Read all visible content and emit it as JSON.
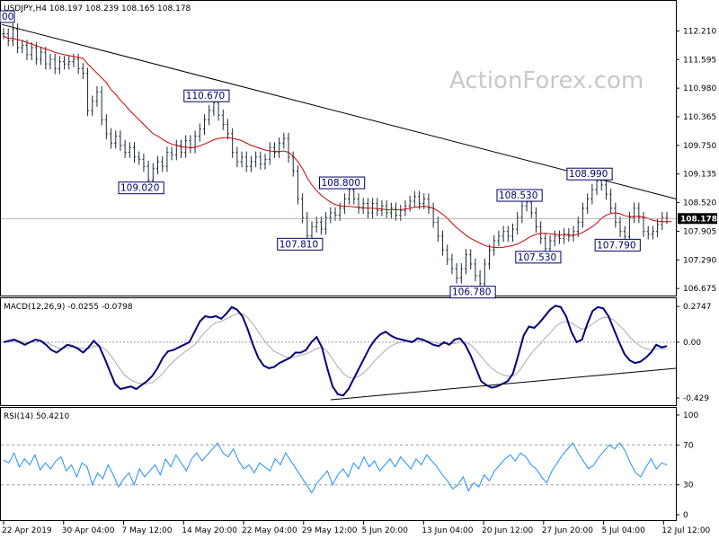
{
  "chart_data": [
    {
      "type": "line",
      "panel": "price",
      "header": "USDJPY,H4  108.197 108.239 108.165 108.178",
      "watermark": "ActionForex.com",
      "ylim": [
        106.6,
        112.45
      ],
      "yticks": [
        "112.210",
        "111.595",
        "110.980",
        "110.365",
        "109.750",
        "109.135",
        "108.520",
        "107.905",
        "107.290",
        "106.675"
      ],
      "current_price": "108.178",
      "partial_left_label": "00",
      "x_labels": [
        "22 Apr 2019",
        "30 Apr 04:00",
        "7 May 12:00",
        "14 May 20:00",
        "22 May 04:00",
        "29 May 12:00",
        "5 Jun 20:00",
        "13 Jun 04:00",
        "20 Jun 12:00",
        "27 Jun 20:00",
        "5 Jul 04:00",
        "12 Jul 12:00"
      ],
      "series": [
        {
          "values": [
            112.15,
            112.0,
            112.25,
            111.85,
            111.9,
            111.7,
            111.85,
            111.6,
            111.75,
            111.5,
            111.6,
            111.4,
            111.55,
            111.5,
            111.55,
            111.6,
            111.4,
            111.3,
            110.5,
            110.7,
            110.9,
            110.3,
            110.0,
            109.8,
            109.95,
            109.75,
            109.6,
            109.7,
            109.5,
            109.45,
            109.3,
            109.0,
            109.25,
            109.4,
            109.3,
            109.6,
            109.55,
            109.75,
            109.6,
            109.85,
            109.7,
            109.95,
            110.1,
            110.3,
            110.5,
            110.67,
            110.4,
            110.2,
            110.0,
            109.6,
            109.4,
            109.5,
            109.3,
            109.4,
            109.5,
            109.35,
            109.45,
            109.7,
            109.6,
            109.8,
            109.9,
            109.5,
            109.2,
            108.6,
            108.2,
            107.81,
            108.0,
            108.1,
            107.95,
            108.2,
            108.3,
            108.25,
            108.4,
            108.6,
            108.8,
            108.6,
            108.4,
            108.5,
            108.3,
            108.5,
            108.35,
            108.45,
            108.3,
            108.4,
            108.25,
            108.35,
            108.45,
            108.55,
            108.65,
            108.5,
            108.6,
            108.4,
            108.1,
            107.8,
            107.5,
            107.3,
            107.1,
            106.9,
            107.1,
            107.4,
            107.2,
            106.95,
            106.78,
            107.2,
            107.5,
            107.7,
            107.8,
            107.9,
            107.8,
            107.95,
            108.2,
            108.45,
            108.53,
            108.3,
            108.0,
            107.75,
            107.53,
            107.7,
            107.8,
            107.75,
            107.85,
            107.8,
            107.9,
            108.1,
            108.4,
            108.6,
            108.8,
            108.99,
            108.9,
            108.7,
            108.4,
            108.1,
            107.9,
            107.79,
            108.2,
            108.4,
            108.2,
            107.9,
            107.85,
            107.9,
            108.05,
            108.2,
            108.18
          ]
        },
        {
          "values": [
            112.1,
            112.05,
            112.05,
            112.02,
            112.0,
            111.96,
            111.93,
            111.89,
            111.86,
            111.82,
            111.79,
            111.75,
            111.72,
            111.7,
            111.68,
            111.66,
            111.64,
            111.62,
            111.5,
            111.4,
            111.3,
            111.2,
            111.1,
            110.95,
            110.85,
            110.72,
            110.62,
            110.5,
            110.4,
            110.3,
            110.2,
            110.1,
            110.0,
            109.95,
            109.88,
            109.82,
            109.78,
            109.75,
            109.72,
            109.71,
            109.7,
            109.71,
            109.74,
            109.78,
            109.82,
            109.87,
            109.9,
            109.91,
            109.92,
            109.9,
            109.88,
            109.85,
            109.8,
            109.75,
            109.72,
            109.68,
            109.65,
            109.63,
            109.62,
            109.62,
            109.63,
            109.6,
            109.52,
            109.4,
            109.25,
            109.05,
            108.9,
            108.78,
            108.68,
            108.6,
            108.53,
            108.48,
            108.45,
            108.44,
            108.44,
            108.43,
            108.42,
            108.41,
            108.4,
            108.4,
            108.39,
            108.38,
            108.37,
            108.37,
            108.37,
            108.37,
            108.38,
            108.4,
            108.42,
            108.43,
            108.44,
            108.43,
            108.4,
            108.34,
            108.27,
            108.18,
            108.08,
            107.98,
            107.9,
            107.82,
            107.75,
            107.7,
            107.65,
            107.6,
            107.57,
            107.56,
            107.55,
            107.56,
            107.58,
            107.6,
            107.63,
            107.68,
            107.74,
            107.8,
            107.84,
            107.86,
            107.86,
            107.85,
            107.84,
            107.83,
            107.82,
            107.82,
            107.82,
            107.84,
            107.88,
            107.94,
            108.0,
            108.08,
            108.18,
            108.25,
            108.29,
            108.3,
            108.28,
            108.24,
            108.22,
            108.22,
            108.23,
            108.21,
            108.18,
            108.14,
            108.12,
            108.11,
            108.11,
            108.11
          ]
        }
      ],
      "annotations": [
        "110.670",
        "109.020",
        "108.800",
        "107.810",
        "108.530",
        "107.530",
        "106.780",
        "108.990",
        "107.790"
      ]
    },
    {
      "type": "line",
      "panel": "macd",
      "header": "MACD(12,26,9) -0.0255 -0.0798",
      "ylim": [
        -0.47,
        0.31
      ],
      "yticks": [
        "0.2747",
        "0.00",
        "-0.429"
      ],
      "series": [
        {
          "values": [
            0.0,
            0.01,
            0.02,
            0.0,
            -0.02,
            0.0,
            0.02,
            0.01,
            -0.02,
            -0.06,
            -0.08,
            -0.05,
            -0.02,
            -0.03,
            -0.05,
            -0.08,
            -0.04,
            0.01,
            -0.03,
            -0.12,
            -0.22,
            -0.32,
            -0.36,
            -0.35,
            -0.34,
            -0.36,
            -0.33,
            -0.3,
            -0.26,
            -0.2,
            -0.12,
            -0.07,
            -0.06,
            -0.04,
            -0.02,
            0.0,
            0.08,
            0.16,
            0.2,
            0.19,
            0.2,
            0.18,
            0.22,
            0.27,
            0.25,
            0.2,
            0.1,
            -0.02,
            -0.12,
            -0.18,
            -0.2,
            -0.19,
            -0.16,
            -0.14,
            -0.12,
            -0.08,
            -0.08,
            -0.06,
            0.0,
            0.04,
            -0.04,
            -0.2,
            -0.34,
            -0.4,
            -0.41,
            -0.36,
            -0.28,
            -0.2,
            -0.12,
            -0.04,
            0.02,
            0.06,
            0.08,
            0.05,
            0.03,
            0.02,
            0.01,
            0.0,
            0.03,
            0.02,
            0.0,
            -0.02,
            -0.03,
            0.0,
            -0.02,
            0.02,
            0.03,
            -0.02,
            -0.1,
            -0.2,
            -0.3,
            -0.33,
            -0.35,
            -0.34,
            -0.32,
            -0.3,
            -0.24,
            -0.1,
            0.05,
            0.12,
            0.11,
            0.15,
            0.2,
            0.25,
            0.28,
            0.27,
            0.2,
            0.08,
            0.0,
            0.02,
            0.14,
            0.24,
            0.27,
            0.26,
            0.2,
            0.1,
            0.0,
            -0.09,
            -0.14,
            -0.16,
            -0.15,
            -0.12,
            -0.08,
            -0.02,
            -0.04,
            -0.03
          ]
        },
        {
          "values": [
            0.0,
            0.0,
            0.01,
            0.01,
            0.0,
            0.0,
            0.0,
            0.01,
            0.0,
            -0.02,
            -0.04,
            -0.05,
            -0.04,
            -0.04,
            -0.04,
            -0.05,
            -0.05,
            -0.03,
            -0.03,
            -0.05,
            -0.09,
            -0.15,
            -0.21,
            -0.26,
            -0.29,
            -0.31,
            -0.32,
            -0.32,
            -0.31,
            -0.28,
            -0.24,
            -0.19,
            -0.15,
            -0.11,
            -0.08,
            -0.05,
            -0.02,
            0.03,
            0.08,
            0.12,
            0.15,
            0.16,
            0.18,
            0.2,
            0.22,
            0.22,
            0.19,
            0.14,
            0.08,
            0.02,
            -0.03,
            -0.07,
            -0.09,
            -0.11,
            -0.12,
            -0.11,
            -0.1,
            -0.09,
            -0.07,
            -0.05,
            -0.04,
            -0.07,
            -0.13,
            -0.19,
            -0.24,
            -0.27,
            -0.28,
            -0.26,
            -0.23,
            -0.19,
            -0.14,
            -0.1,
            -0.06,
            -0.03,
            -0.01,
            0.0,
            0.01,
            0.01,
            0.01,
            0.01,
            0.01,
            0.0,
            -0.01,
            -0.01,
            -0.01,
            -0.01,
            0.0,
            0.0,
            -0.02,
            -0.06,
            -0.11,
            -0.16,
            -0.2,
            -0.23,
            -0.25,
            -0.26,
            -0.26,
            -0.23,
            -0.17,
            -0.11,
            -0.06,
            -0.02,
            0.03,
            0.07,
            0.12,
            0.15,
            0.16,
            0.15,
            0.12,
            0.1,
            0.11,
            0.14,
            0.17,
            0.19,
            0.19,
            0.17,
            0.13,
            0.09,
            0.04,
            0.0,
            -0.03,
            -0.05,
            -0.06,
            -0.05,
            -0.05,
            -0.05
          ]
        }
      ]
    },
    {
      "type": "line",
      "panel": "rsi",
      "header": "RSI(14) 50.4210",
      "ylim": [
        0,
        100
      ],
      "yticks": [
        "100",
        "70",
        "30",
        "0"
      ],
      "series": [
        {
          "values": [
            55,
            52,
            62,
            48,
            56,
            50,
            60,
            45,
            52,
            46,
            54,
            58,
            44,
            50,
            38,
            52,
            48,
            30,
            42,
            36,
            50,
            40,
            28,
            36,
            42,
            30,
            46,
            38,
            44,
            50,
            40,
            56,
            48,
            60,
            52,
            44,
            56,
            62,
            54,
            60,
            66,
            72,
            62,
            58,
            66,
            54,
            46,
            50,
            42,
            52,
            48,
            44,
            56,
            50,
            62,
            54,
            46,
            38,
            30,
            22,
            32,
            38,
            44,
            30,
            40,
            46,
            38,
            52,
            46,
            58,
            48,
            54,
            44,
            50,
            56,
            48,
            58,
            52,
            46,
            56,
            50,
            60,
            54,
            48,
            40,
            34,
            26,
            30,
            38,
            24,
            32,
            28,
            40,
            34,
            44,
            50,
            56,
            60,
            54,
            62,
            58,
            50,
            46,
            38,
            32,
            44,
            52,
            60,
            66,
            72,
            62,
            54,
            46,
            50,
            58,
            64,
            70,
            66,
            72,
            64,
            52,
            42,
            38,
            48,
            56,
            46,
            52,
            50
          ]
        }
      ]
    }
  ]
}
